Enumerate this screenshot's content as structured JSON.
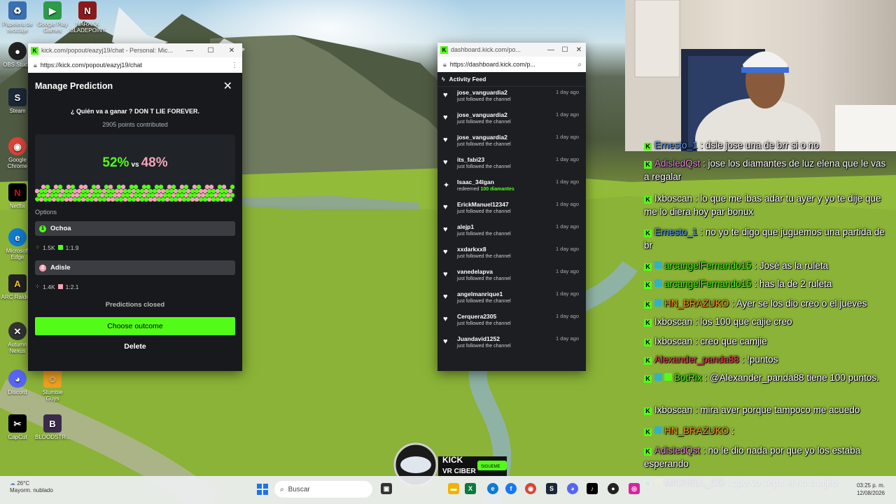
{
  "desktop": {
    "icons": [
      {
        "label": "Papelera de reciclaje",
        "icon": "recycle-bin-icon"
      },
      {
        "label": "Google Play Games",
        "icon": "google-play-games-icon"
      },
      {
        "label": "NARAKA BLADEPOINT",
        "icon": "naraka-icon"
      },
      {
        "label": "OBS Studio",
        "icon": "obs-icon"
      },
      {
        "label": "Steam",
        "icon": "steam-icon"
      },
      {
        "label": "Google Chrome",
        "icon": "chrome-icon"
      },
      {
        "label": "Netflix",
        "icon": "netflix-icon"
      },
      {
        "label": "Microsoft Edge",
        "icon": "edge-icon"
      },
      {
        "label": "ARC Raiders",
        "icon": "arc-raiders-icon"
      },
      {
        "label": "Autumn Nexus",
        "icon": "autumn-icon"
      },
      {
        "label": "Discord",
        "icon": "discord-icon"
      },
      {
        "label": "Stumble Guys",
        "icon": "stumble-guys-icon"
      },
      {
        "label": "CapCut",
        "icon": "capcut-icon"
      },
      {
        "label": "BLOODSTR...",
        "icon": "bloodstrike-icon"
      }
    ]
  },
  "chat_window": {
    "title": "kick.com/popout/eazyj19/chat - Personal: Mic...",
    "url": "https://kick.com/popout/eazyj19/chat",
    "prediction": {
      "heading": "Manage Prediction",
      "question": "¿ Quién va a ganar ? DON T LIE FOREVER.",
      "points": "2905 points contributed",
      "pct_a": "52%",
      "vs": "vs",
      "pct_b": "48%",
      "options_label": "Options",
      "option_a": {
        "num": "1",
        "name": "Ochoa",
        "points": "1.5K",
        "ratio": "1:1.9",
        "color": "#53fc18"
      },
      "option_b": {
        "num": "2",
        "name": "Adisle",
        "points": "1.4K",
        "ratio": "1:2.1",
        "color": "#f3a3b8"
      },
      "status": "Predictions closed",
      "choose_label": "Choose outcome",
      "delete_label": "Delete"
    }
  },
  "dashboard_window": {
    "title": "dashboard.kick.com/po...",
    "url": "https://dashboard.kick.com/p...",
    "feed_title": "Activity Feed",
    "items": [
      {
        "name": "jose_vanguardia2",
        "desc": "just followed the channel",
        "time": "1 day ago"
      },
      {
        "name": "jose_vanguardia2",
        "desc": "just followed the channel",
        "time": "1 day ago"
      },
      {
        "name": "jose_vanguardia2",
        "desc": "just followed the channel",
        "time": "1 day ago"
      },
      {
        "name": "its_fabi23",
        "desc": "just followed the channel",
        "time": "1 day ago"
      },
      {
        "name": "Isaac_34lgan",
        "desc": "redeemed",
        "highlight": "100 diamantes",
        "time": "1 day ago"
      },
      {
        "name": "ErickManuel12347",
        "desc": "just followed the channel",
        "time": "1 day ago"
      },
      {
        "name": "alejp1",
        "desc": "just followed the channel",
        "time": "1 day ago"
      },
      {
        "name": "xxdarkxx8",
        "desc": "just followed the channel",
        "time": "1 day ago"
      },
      {
        "name": "vanedelapva",
        "desc": "just followed the channel",
        "time": "1 day ago"
      },
      {
        "name": "angelmanrique1",
        "desc": "just followed the channel",
        "time": "1 day ago"
      },
      {
        "name": "Cerquera2305",
        "desc": "just followed the channel",
        "time": "1 day ago"
      },
      {
        "name": "Juandavid1252",
        "desc": "just followed the channel",
        "time": "1 day ago"
      }
    ]
  },
  "overlay_chat": [
    {
      "user": "Ernesto_1",
      "color": "#5aa0ff",
      "text": "dsle jose una de brr si o no",
      "badges": []
    },
    {
      "user": "AdisledQst",
      "color": "#e58ad6",
      "text": "jose los diamantes de luz elena que le vas a regalar",
      "badges": []
    },
    {
      "user": "Ixboscan",
      "color": "#ffffff",
      "text": "lo que me ibas adar tu ayer y yo te dije que me lo diera hoy par bonux",
      "badges": []
    },
    {
      "user": "Ernesto_1",
      "color": "#5aa0ff",
      "text": "no yo te digo que juguemos una partida de br",
      "badges": []
    },
    {
      "user": "arcangelFernando15",
      "color": "#53fc18",
      "text": "José as la ruleta",
      "badges": [
        "#2fb3c9"
      ]
    },
    {
      "user": "arcangelFernando15",
      "color": "#53fc18",
      "text": "has la de 2 ruleta",
      "badges": [
        "#2fb3c9"
      ]
    },
    {
      "user": "HN_BRAZUKO",
      "color": "#ff9a1f",
      "text": "Ayer se los dio creo o el jueves",
      "badges": [
        "#2fb3c9"
      ]
    },
    {
      "user": "Ixboscan",
      "color": "#ffffff",
      "text": "los 100 que cajie creo",
      "badges": []
    },
    {
      "user": "Ixboscan",
      "color": "#ffffff",
      "text": "creo que camjie",
      "badges": []
    },
    {
      "user": "Alexander_panda88",
      "color": "#ff3b5c",
      "text": "!puntos",
      "badges": []
    },
    {
      "user": "BotRix",
      "color": "#53fc18",
      "text": "@Alexander_panda88 tiene 100 puntos.",
      "badges": [
        "#2fb3c9",
        "#53fc18"
      ]
    },
    {
      "user": "Ixboscan",
      "color": "#ffffff",
      "text": "mira aver porque tampoco me acuedo",
      "badges": []
    },
    {
      "user": "HN_BRAZUKO",
      "color": "#ff9a1f",
      "text": "",
      "badges": [
        "#2fb3c9"
      ]
    },
    {
      "user": "AdisledQst",
      "color": "#e58ad6",
      "text": "no le dio nada por que yo los estaba esperando",
      "badges": []
    },
    {
      "user": "MICHELL_CD",
      "color": "#e58ad6",
      "text": "que yo sepa el no canjeo",
      "badges": [
        "#f0b400"
      ]
    }
  ],
  "stream_logo": {
    "line1": "KICK",
    "line2": "VR CIBER",
    "badge": "SIGUEME"
  },
  "taskbar": {
    "weather_temp": "26°C",
    "weather_desc": "Mayorm. nublado",
    "search_placeholder": "Buscar",
    "time": "03:25 p. m.",
    "date": "12/08/2026"
  }
}
